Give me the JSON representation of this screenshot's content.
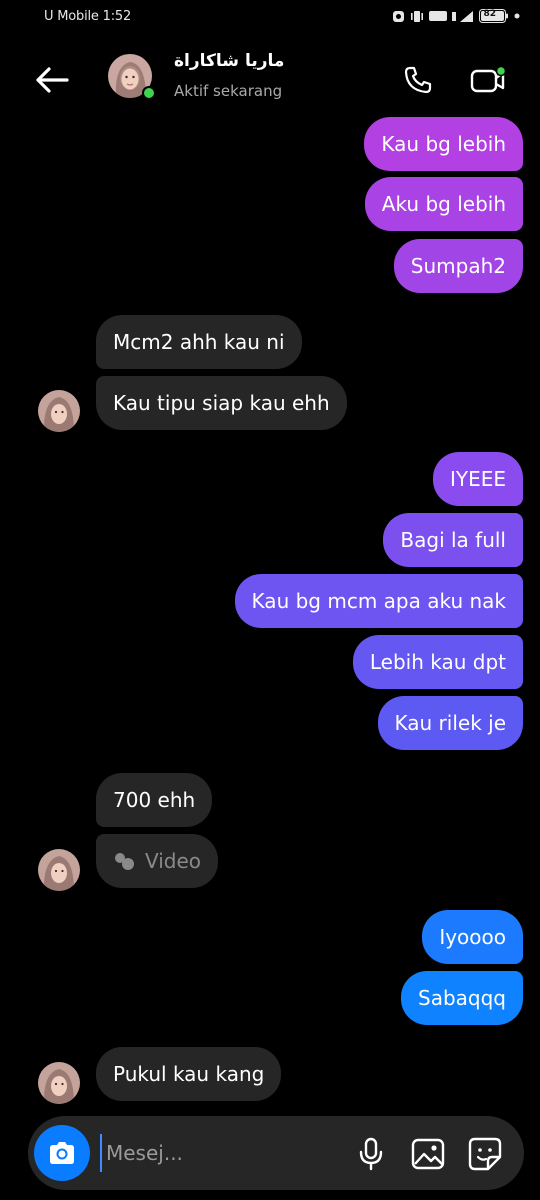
{
  "status_bar": {
    "carrier_time": "U Mobile 1:52",
    "battery": "82"
  },
  "header": {
    "contact_name": "ماريا شاكاراة",
    "contact_status": "Aktif sekarang"
  },
  "colors": {
    "sent_gradient": [
      "#b43fe3",
      "#8b4cf0",
      "#5f59f2",
      "#0f82ff"
    ],
    "received": "#262626",
    "online": "#3fd44c",
    "accent": "#0a7cff"
  },
  "messages": [
    {
      "from": "me",
      "text": "Kau bg lebih"
    },
    {
      "from": "me",
      "text": "Aku bg lebih"
    },
    {
      "from": "me",
      "text": "Sumpah2"
    },
    {
      "from": "them",
      "text": "Mcm2 ahh kau ni"
    },
    {
      "from": "them",
      "text": "Kau tipu siap kau ehh"
    },
    {
      "from": "me",
      "text": "IYEEE"
    },
    {
      "from": "me",
      "text": "Bagi la full"
    },
    {
      "from": "me",
      "text": "Kau bg mcm apa aku nak"
    },
    {
      "from": "me",
      "text": "Lebih kau dpt"
    },
    {
      "from": "me",
      "text": "Kau rilek je"
    },
    {
      "from": "them",
      "text": "700 ehh"
    },
    {
      "from": "them",
      "text": "Video",
      "type": "video",
      "icon": "video-icon"
    },
    {
      "from": "me",
      "text": "Iyoooo"
    },
    {
      "from": "me",
      "text": "Sabaqqq"
    },
    {
      "from": "them",
      "text": "Pukul kau kang"
    }
  ],
  "composer": {
    "placeholder": "Mesej...",
    "icons": [
      "camera-icon",
      "microphone-icon",
      "gallery-icon",
      "sticker-icon"
    ]
  }
}
